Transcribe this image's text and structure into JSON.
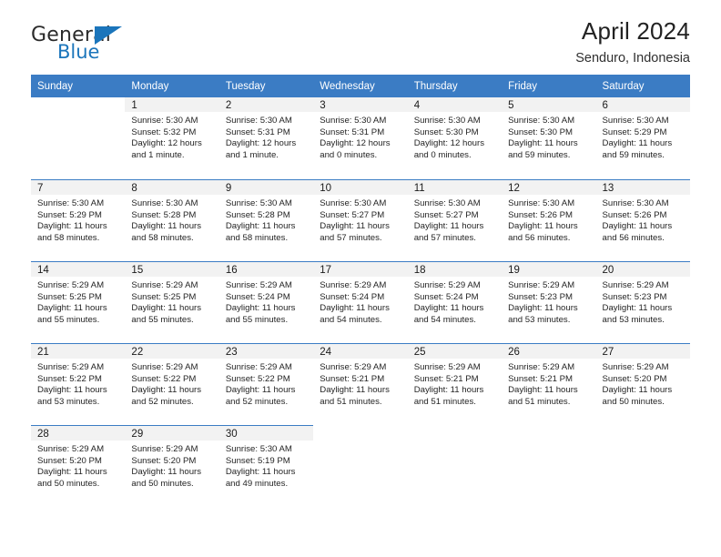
{
  "brand": {
    "name_top": "General",
    "name_bottom": "Blue"
  },
  "header": {
    "title": "April 2024",
    "subtitle": "Senduro, Indonesia"
  },
  "colors": {
    "header_blue": "#3b7cc4",
    "brand_blue": "#1b75bb",
    "daynum_bg": "#f2f2f2"
  },
  "weekdays": [
    "Sunday",
    "Monday",
    "Tuesday",
    "Wednesday",
    "Thursday",
    "Friday",
    "Saturday"
  ],
  "weeks": [
    [
      {
        "day": "",
        "empty": true,
        "sunrise": "",
        "sunset": "",
        "daylight1": "",
        "daylight2": ""
      },
      {
        "day": "1",
        "sunrise": "Sunrise: 5:30 AM",
        "sunset": "Sunset: 5:32 PM",
        "daylight1": "Daylight: 12 hours",
        "daylight2": "and 1 minute."
      },
      {
        "day": "2",
        "sunrise": "Sunrise: 5:30 AM",
        "sunset": "Sunset: 5:31 PM",
        "daylight1": "Daylight: 12 hours",
        "daylight2": "and 1 minute."
      },
      {
        "day": "3",
        "sunrise": "Sunrise: 5:30 AM",
        "sunset": "Sunset: 5:31 PM",
        "daylight1": "Daylight: 12 hours",
        "daylight2": "and 0 minutes."
      },
      {
        "day": "4",
        "sunrise": "Sunrise: 5:30 AM",
        "sunset": "Sunset: 5:30 PM",
        "daylight1": "Daylight: 12 hours",
        "daylight2": "and 0 minutes."
      },
      {
        "day": "5",
        "sunrise": "Sunrise: 5:30 AM",
        "sunset": "Sunset: 5:30 PM",
        "daylight1": "Daylight: 11 hours",
        "daylight2": "and 59 minutes."
      },
      {
        "day": "6",
        "sunrise": "Sunrise: 5:30 AM",
        "sunset": "Sunset: 5:29 PM",
        "daylight1": "Daylight: 11 hours",
        "daylight2": "and 59 minutes."
      }
    ],
    [
      {
        "day": "7",
        "sunrise": "Sunrise: 5:30 AM",
        "sunset": "Sunset: 5:29 PM",
        "daylight1": "Daylight: 11 hours",
        "daylight2": "and 58 minutes."
      },
      {
        "day": "8",
        "sunrise": "Sunrise: 5:30 AM",
        "sunset": "Sunset: 5:28 PM",
        "daylight1": "Daylight: 11 hours",
        "daylight2": "and 58 minutes."
      },
      {
        "day": "9",
        "sunrise": "Sunrise: 5:30 AM",
        "sunset": "Sunset: 5:28 PM",
        "daylight1": "Daylight: 11 hours",
        "daylight2": "and 58 minutes."
      },
      {
        "day": "10",
        "sunrise": "Sunrise: 5:30 AM",
        "sunset": "Sunset: 5:27 PM",
        "daylight1": "Daylight: 11 hours",
        "daylight2": "and 57 minutes."
      },
      {
        "day": "11",
        "sunrise": "Sunrise: 5:30 AM",
        "sunset": "Sunset: 5:27 PM",
        "daylight1": "Daylight: 11 hours",
        "daylight2": "and 57 minutes."
      },
      {
        "day": "12",
        "sunrise": "Sunrise: 5:30 AM",
        "sunset": "Sunset: 5:26 PM",
        "daylight1": "Daylight: 11 hours",
        "daylight2": "and 56 minutes."
      },
      {
        "day": "13",
        "sunrise": "Sunrise: 5:30 AM",
        "sunset": "Sunset: 5:26 PM",
        "daylight1": "Daylight: 11 hours",
        "daylight2": "and 56 minutes."
      }
    ],
    [
      {
        "day": "14",
        "sunrise": "Sunrise: 5:29 AM",
        "sunset": "Sunset: 5:25 PM",
        "daylight1": "Daylight: 11 hours",
        "daylight2": "and 55 minutes."
      },
      {
        "day": "15",
        "sunrise": "Sunrise: 5:29 AM",
        "sunset": "Sunset: 5:25 PM",
        "daylight1": "Daylight: 11 hours",
        "daylight2": "and 55 minutes."
      },
      {
        "day": "16",
        "sunrise": "Sunrise: 5:29 AM",
        "sunset": "Sunset: 5:24 PM",
        "daylight1": "Daylight: 11 hours",
        "daylight2": "and 55 minutes."
      },
      {
        "day": "17",
        "sunrise": "Sunrise: 5:29 AM",
        "sunset": "Sunset: 5:24 PM",
        "daylight1": "Daylight: 11 hours",
        "daylight2": "and 54 minutes."
      },
      {
        "day": "18",
        "sunrise": "Sunrise: 5:29 AM",
        "sunset": "Sunset: 5:24 PM",
        "daylight1": "Daylight: 11 hours",
        "daylight2": "and 54 minutes."
      },
      {
        "day": "19",
        "sunrise": "Sunrise: 5:29 AM",
        "sunset": "Sunset: 5:23 PM",
        "daylight1": "Daylight: 11 hours",
        "daylight2": "and 53 minutes."
      },
      {
        "day": "20",
        "sunrise": "Sunrise: 5:29 AM",
        "sunset": "Sunset: 5:23 PM",
        "daylight1": "Daylight: 11 hours",
        "daylight2": "and 53 minutes."
      }
    ],
    [
      {
        "day": "21",
        "sunrise": "Sunrise: 5:29 AM",
        "sunset": "Sunset: 5:22 PM",
        "daylight1": "Daylight: 11 hours",
        "daylight2": "and 53 minutes."
      },
      {
        "day": "22",
        "sunrise": "Sunrise: 5:29 AM",
        "sunset": "Sunset: 5:22 PM",
        "daylight1": "Daylight: 11 hours",
        "daylight2": "and 52 minutes."
      },
      {
        "day": "23",
        "sunrise": "Sunrise: 5:29 AM",
        "sunset": "Sunset: 5:22 PM",
        "daylight1": "Daylight: 11 hours",
        "daylight2": "and 52 minutes."
      },
      {
        "day": "24",
        "sunrise": "Sunrise: 5:29 AM",
        "sunset": "Sunset: 5:21 PM",
        "daylight1": "Daylight: 11 hours",
        "daylight2": "and 51 minutes."
      },
      {
        "day": "25",
        "sunrise": "Sunrise: 5:29 AM",
        "sunset": "Sunset: 5:21 PM",
        "daylight1": "Daylight: 11 hours",
        "daylight2": "and 51 minutes."
      },
      {
        "day": "26",
        "sunrise": "Sunrise: 5:29 AM",
        "sunset": "Sunset: 5:21 PM",
        "daylight1": "Daylight: 11 hours",
        "daylight2": "and 51 minutes."
      },
      {
        "day": "27",
        "sunrise": "Sunrise: 5:29 AM",
        "sunset": "Sunset: 5:20 PM",
        "daylight1": "Daylight: 11 hours",
        "daylight2": "and 50 minutes."
      }
    ],
    [
      {
        "day": "28",
        "sunrise": "Sunrise: 5:29 AM",
        "sunset": "Sunset: 5:20 PM",
        "daylight1": "Daylight: 11 hours",
        "daylight2": "and 50 minutes."
      },
      {
        "day": "29",
        "sunrise": "Sunrise: 5:29 AM",
        "sunset": "Sunset: 5:20 PM",
        "daylight1": "Daylight: 11 hours",
        "daylight2": "and 50 minutes."
      },
      {
        "day": "30",
        "sunrise": "Sunrise: 5:30 AM",
        "sunset": "Sunset: 5:19 PM",
        "daylight1": "Daylight: 11 hours",
        "daylight2": "and 49 minutes."
      },
      {
        "day": "",
        "empty": true,
        "sunrise": "",
        "sunset": "",
        "daylight1": "",
        "daylight2": ""
      },
      {
        "day": "",
        "empty": true,
        "sunrise": "",
        "sunset": "",
        "daylight1": "",
        "daylight2": ""
      },
      {
        "day": "",
        "empty": true,
        "sunrise": "",
        "sunset": "",
        "daylight1": "",
        "daylight2": ""
      },
      {
        "day": "",
        "empty": true,
        "sunrise": "",
        "sunset": "",
        "daylight1": "",
        "daylight2": ""
      }
    ]
  ]
}
